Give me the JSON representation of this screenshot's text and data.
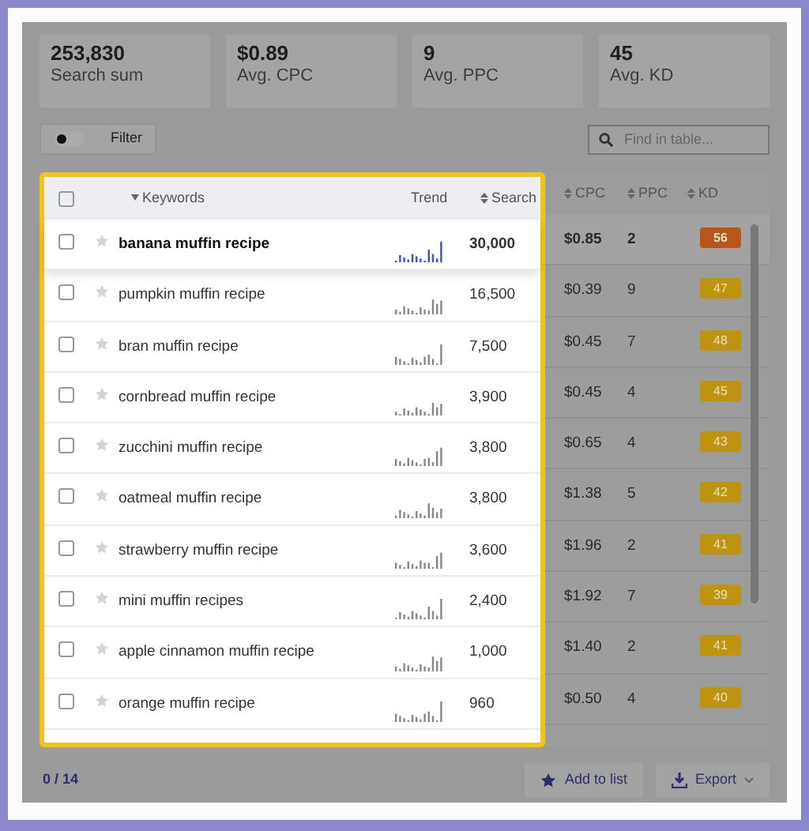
{
  "stats": [
    {
      "value": "253,830",
      "label": "Search sum"
    },
    {
      "value": "$0.89",
      "label": "Avg. CPC"
    },
    {
      "value": "9",
      "label": "Avg. PPC"
    },
    {
      "value": "45",
      "label": "Avg. KD"
    }
  ],
  "filter": {
    "label": "Filter",
    "on": false
  },
  "search": {
    "placeholder": "Find in table..."
  },
  "columns": {
    "keywords": "Keywords",
    "trend": "Trend",
    "search": "Search",
    "cpc": "CPC",
    "ppc": "PPC",
    "kd": "KD"
  },
  "select_all": {
    "checked": false
  },
  "rows": [
    {
      "keyword": "banana muffin recipe",
      "highlighted": true,
      "checked": false,
      "starred": false,
      "search": "30,000",
      "cpc": "$0.85",
      "ppc": "2",
      "kd": "56",
      "color": "#b5561c"
    },
    {
      "keyword": "pumpkin muffin recipe",
      "highlighted": false,
      "checked": false,
      "starred": false,
      "search": "16,500",
      "cpc": "$0.39",
      "ppc": "9",
      "kd": "47",
      "color": "#bf9410"
    },
    {
      "keyword": "bran muffin recipe",
      "highlighted": false,
      "checked": false,
      "starred": false,
      "search": "7,500",
      "cpc": "$0.45",
      "ppc": "7",
      "kd": "48",
      "color": "#bf9410"
    },
    {
      "keyword": "cornbread muffin recipe",
      "highlighted": false,
      "checked": false,
      "starred": false,
      "search": "3,900",
      "cpc": "$0.45",
      "ppc": "4",
      "kd": "45",
      "color": "#bf9410"
    },
    {
      "keyword": "zucchini muffin recipe",
      "highlighted": false,
      "checked": false,
      "starred": false,
      "search": "3,800",
      "cpc": "$0.65",
      "ppc": "4",
      "kd": "43",
      "color": "#bf9410"
    },
    {
      "keyword": "oatmeal muffin recipe",
      "highlighted": false,
      "checked": false,
      "starred": false,
      "search": "3,800",
      "cpc": "$1.38",
      "ppc": "5",
      "kd": "42",
      "color": "#bf9410"
    },
    {
      "keyword": "strawberry muffin recipe",
      "highlighted": false,
      "checked": false,
      "starred": false,
      "search": "3,600",
      "cpc": "$1.96",
      "ppc": "2",
      "kd": "41",
      "color": "#bf9410"
    },
    {
      "keyword": "mini muffin recipes",
      "highlighted": false,
      "checked": false,
      "starred": false,
      "search": "2,400",
      "cpc": "$1.92",
      "ppc": "7",
      "kd": "39",
      "color": "#bf9410"
    },
    {
      "keyword": "apple cinnamon muffin recipe",
      "highlighted": false,
      "checked": false,
      "starred": false,
      "search": "1,000",
      "cpc": "$1.40",
      "ppc": "2",
      "kd": "41",
      "color": "#bf9410"
    },
    {
      "keyword": "orange muffin recipe",
      "highlighted": false,
      "checked": false,
      "starred": false,
      "search": "960",
      "cpc": "$0.50",
      "ppc": "4",
      "kd": "40",
      "color": "#bf9410"
    }
  ],
  "footer": {
    "count": "0 / 14",
    "add_button": "Add to list",
    "export_button": "Export"
  }
}
